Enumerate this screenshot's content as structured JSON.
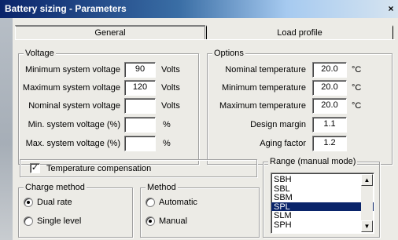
{
  "window": {
    "title": "Battery sizing - Parameters",
    "close_glyph": "×"
  },
  "tabs": [
    {
      "label": "General",
      "active": true
    },
    {
      "label": "Load profile",
      "active": false
    }
  ],
  "voltage": {
    "legend": "Voltage",
    "rows": [
      {
        "label": "Minimum system voltage",
        "value": "90",
        "unit": "Volts"
      },
      {
        "label": "Maximum system voltage",
        "value": "120",
        "unit": "Volts"
      },
      {
        "label": "Nominal system voltage",
        "value": "",
        "unit": "Volts"
      },
      {
        "label": "Min. system voltage (%)",
        "value": "",
        "unit": "%"
      },
      {
        "label": "Max. system voltage (%)",
        "value": "",
        "unit": "%"
      }
    ]
  },
  "options": {
    "legend": "Options",
    "rows": [
      {
        "label": "Nominal temperature",
        "value": "20.0",
        "unit": "°C"
      },
      {
        "label": "Minimum temperature",
        "value": "20.0",
        "unit": "°C"
      },
      {
        "label": "Maximum temperature",
        "value": "20.0",
        "unit": "°C"
      },
      {
        "label": "Design margin",
        "value": "1.1",
        "unit": ""
      },
      {
        "label": "Aging factor",
        "value": "1.2",
        "unit": ""
      }
    ]
  },
  "temperature_compensation": {
    "label": "Temperature compensation",
    "checked": true,
    "check_glyph": "✓"
  },
  "charge_method": {
    "legend": "Charge method",
    "options": [
      {
        "label": "Dual rate",
        "selected": true
      },
      {
        "label": "Single level",
        "selected": false
      }
    ]
  },
  "method": {
    "legend": "Method",
    "options": [
      {
        "label": "Automatic",
        "selected": false
      },
      {
        "label": "Manual",
        "selected": true
      }
    ]
  },
  "range": {
    "legend": "Range (manual mode)",
    "items": [
      "SBH",
      "SBL",
      "SBM",
      "SPL",
      "SLM",
      "SPH"
    ],
    "selected": "SPL",
    "scroll_up": "▲",
    "scroll_down": "▼"
  }
}
